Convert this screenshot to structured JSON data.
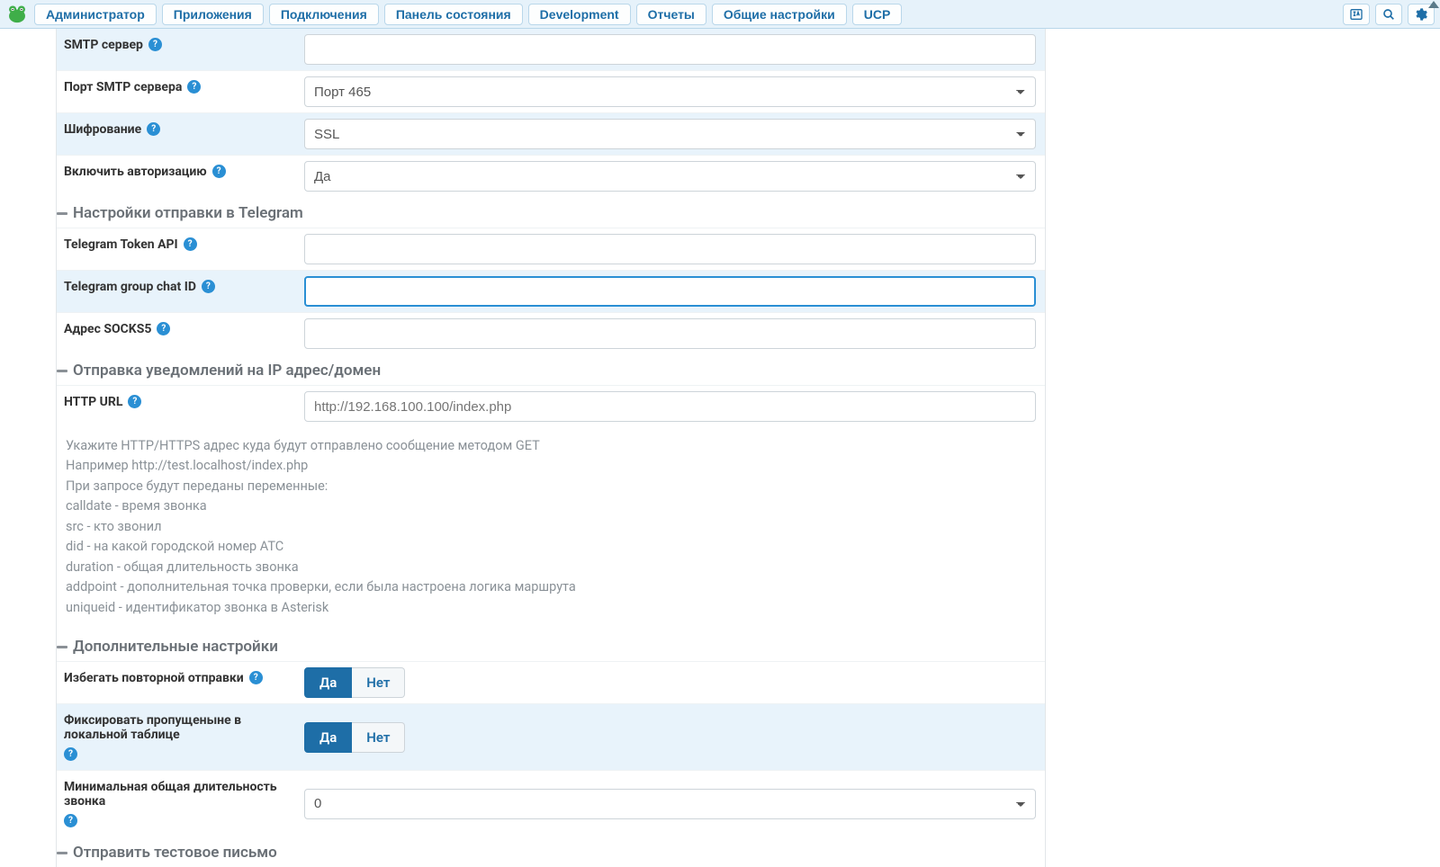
{
  "nav": {
    "items": [
      "Администратор",
      "Приложения",
      "Подключения",
      "Панель состояния",
      "Development",
      "Отчеты",
      "Общие настройки",
      "UCP"
    ]
  },
  "smtp": {
    "server_label": "SMTP сервер",
    "port_label": "Порт SMTP сервера",
    "port_value": "Порт 465",
    "enc_label": "Шифрование",
    "enc_value": "SSL",
    "auth_label": "Включить авторизацию",
    "auth_value": "Да"
  },
  "sections": {
    "telegram": "Настройки отправки в Telegram",
    "ipdomain": "Отправка уведомлений на IP адрес/домен",
    "extra": "Дополнительные настройки",
    "testmail": "Отправить тестовое письмо"
  },
  "telegram": {
    "token_label": "Telegram Token API",
    "chatid_label": "Telegram group chat ID",
    "socks_label": "Адрес SOCKS5"
  },
  "http": {
    "url_label": "HTTP URL",
    "placeholder": "http://192.168.100.100/index.php",
    "help_lines": [
      "Укажите HTTP/HTTPS адрес куда будут отправлено сообщение методом GET",
      "Например http://test.localhost/index.php",
      "При запросе будут переданы переменные:",
      "calldate - время звонка",
      "src - кто звонил",
      "did - на какой городской номер АТС",
      "duration - общая длительность звонка",
      "addpoint - дополнительная точка проверки, если была настроена логика маршрута",
      "uniqueid - идентификатор звонка в Asterisk"
    ]
  },
  "extra": {
    "avoid_label": "Избегать повторной отправки",
    "record_label": "Фиксировать пропущеныне в локальной таблице",
    "min_label": "Минимальная общая длительность звонка",
    "min_value": "0",
    "yes": "Да",
    "no": "Нет"
  }
}
